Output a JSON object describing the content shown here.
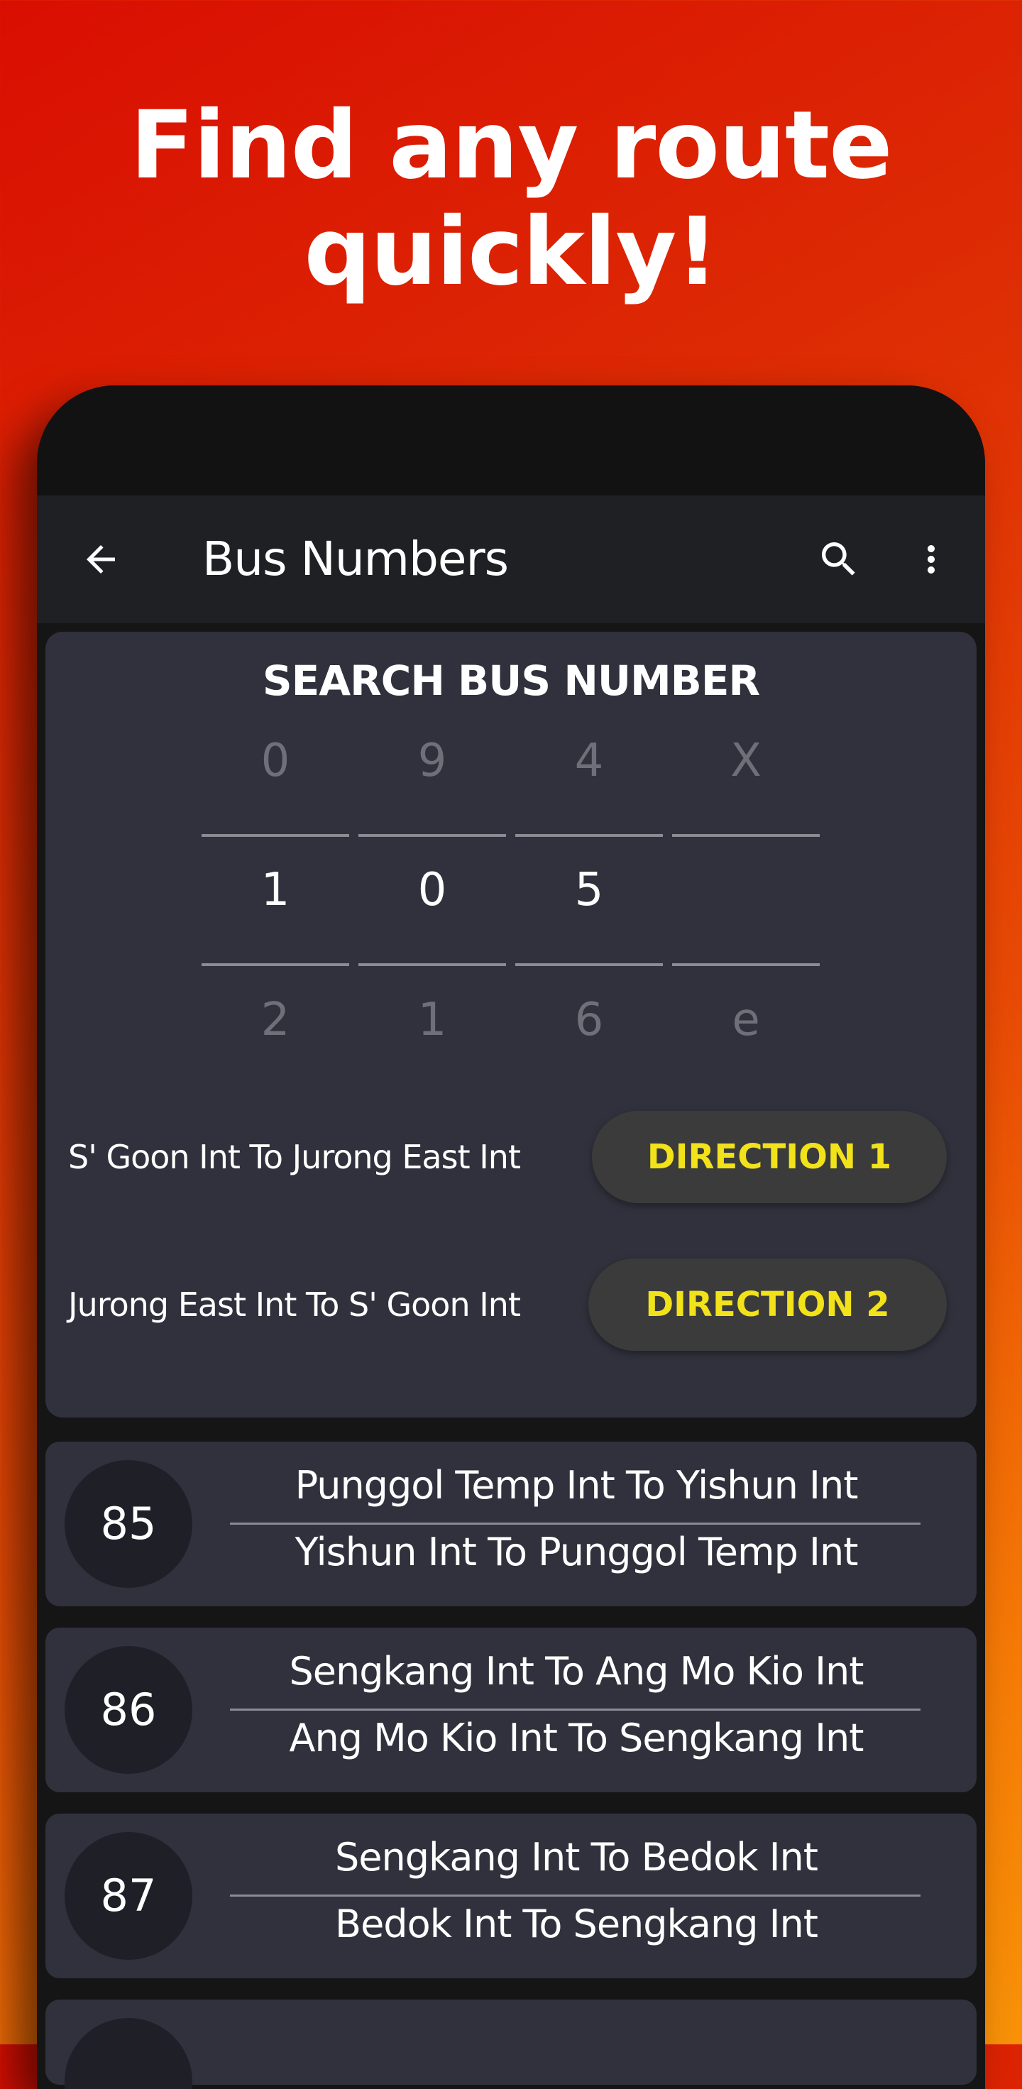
{
  "promo": {
    "headline_line1": "Find any route",
    "headline_line2": "quickly!"
  },
  "colors": {
    "background_start": "#d90e02",
    "background_end": "#f89208",
    "app_bar": "#1f2024",
    "card": "#30313c",
    "direction_text": "#f2e21a",
    "number_badge": "#1e1f27"
  },
  "app_bar": {
    "back_icon": "arrow-left-icon",
    "title": "Bus Numbers",
    "search_icon": "search-icon",
    "more_icon": "more-vertical-icon"
  },
  "search": {
    "title": "SEARCH BUS NUMBER",
    "columns": [
      {
        "prev": "0",
        "selected": "1",
        "next": "2"
      },
      {
        "prev": "9",
        "selected": "0",
        "next": "1"
      },
      {
        "prev": "4",
        "selected": "5",
        "next": "6"
      },
      {
        "prev": "X",
        "selected": "",
        "next": "e"
      }
    ],
    "directions": [
      {
        "label": "S' Goon Int To Jurong East Int",
        "button": "DIRECTION 1"
      },
      {
        "label": "Jurong East Int To S' Goon Int",
        "button": "DIRECTION 2"
      }
    ]
  },
  "routes": [
    {
      "number": "85",
      "forward": "Punggol Temp Int To Yishun Int",
      "reverse": "Yishun Int To Punggol Temp Int"
    },
    {
      "number": "86",
      "forward": "Sengkang Int To Ang Mo Kio Int",
      "reverse": "Ang Mo Kio Int To Sengkang Int"
    },
    {
      "number": "87",
      "forward": "Sengkang Int To Bedok Int",
      "reverse": "Bedok Int To Sengkang Int"
    }
  ]
}
